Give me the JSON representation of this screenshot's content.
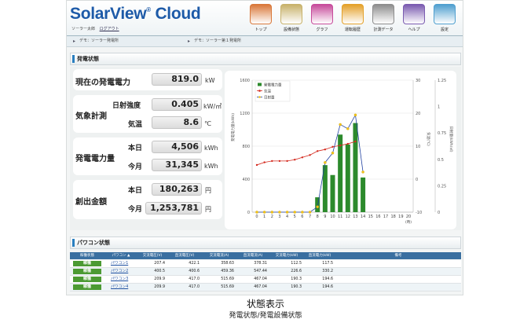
{
  "app": {
    "logo": "SolarView",
    "logo_reg": "®",
    "logo_suffix": " Cloud",
    "login": {
      "user": "ソーラー太郎",
      "logout": "ログアウト"
    }
  },
  "nav": [
    {
      "label": "トップ",
      "icon": "house-icon",
      "color": "#d9783a"
    },
    {
      "label": "設備状態",
      "icon": "panel-icon",
      "color": "#c8b26b"
    },
    {
      "label": "グラフ",
      "icon": "bar-graph-icon",
      "color": "#c74b9b"
    },
    {
      "label": "運転履歴",
      "icon": "log-icon",
      "color": "#e4a12a"
    },
    {
      "label": "計測データ",
      "icon": "data-icon",
      "color": "#8d8d8d"
    },
    {
      "label": "ヘルプ",
      "icon": "help-icon",
      "color": "#7a5bb0"
    },
    {
      "label": "設定",
      "icon": "settings-icon",
      "color": "#4f9fcf"
    }
  ],
  "breadcrumbs": [
    "デモ：ソーラー発電所",
    "デモ：ソーラー第１発電所"
  ],
  "status": {
    "title": "発電状態",
    "current_power": {
      "label": "現在の発電電力",
      "value": "819.0",
      "unit": "kW"
    },
    "weather": {
      "label": "気象計測",
      "irradiance": {
        "label": "日射強度",
        "value": "0.405",
        "unit": "kW/㎡"
      },
      "temperature": {
        "label": "気温",
        "value": "8.6",
        "unit": "℃"
      }
    },
    "energy": {
      "label": "発電電力量",
      "today": {
        "label": "本日",
        "value": "4,506",
        "unit": "kWh"
      },
      "month": {
        "label": "今月",
        "value": "31,345",
        "unit": "kWh"
      }
    },
    "money": {
      "label": "創出金額",
      "today": {
        "label": "本日",
        "value": "180,263",
        "unit": "円"
      },
      "month": {
        "label": "今月",
        "value": "1,253,781",
        "unit": "円"
      }
    }
  },
  "chart_data": {
    "type": "bar",
    "x": [
      0,
      1,
      2,
      3,
      4,
      5,
      6,
      7,
      8,
      9,
      10,
      11,
      12,
      13,
      14,
      15,
      16,
      17,
      18,
      19,
      20
    ],
    "xlabel": "(時)",
    "series": [
      {
        "name": "発電電力量",
        "type": "bar",
        "axis": "left",
        "color": "#2c8a2c",
        "values": [
          0,
          0,
          0,
          0,
          0,
          0,
          0,
          0,
          180,
          570,
          450,
          940,
          820,
          1080,
          420,
          null,
          null,
          null,
          null,
          null,
          null
        ]
      },
      {
        "name": "気温",
        "type": "line",
        "axis": "right1",
        "color": "#d42a1f",
        "values": [
          null,
          null,
          null,
          null,
          null,
          null,
          null,
          null,
          null,
          null,
          null,
          null,
          null,
          null,
          null,
          null,
          null,
          null,
          null,
          null,
          null
        ]
      },
      {
        "name": "日射量",
        "type": "line",
        "axis": "right2",
        "color": "#2040a0",
        "marker_color": "#f3c41a",
        "values": [
          0,
          0,
          0,
          0,
          0,
          0,
          0,
          0,
          0.05,
          0.47,
          0.56,
          0.83,
          0.79,
          0.92,
          0.38,
          null,
          null,
          null,
          null,
          null,
          null
        ]
      }
    ],
    "temperature": {
      "hours": [
        0,
        1,
        2,
        3,
        4,
        5,
        6,
        7,
        8,
        9,
        10,
        11,
        12,
        13
      ],
      "values": [
        4.3,
        5.1,
        5.5,
        5.5,
        5.5,
        5.9,
        6.6,
        7.3,
        8.5,
        9.0,
        9.8,
        10.2,
        10.7,
        11.4
      ]
    },
    "left_axis": {
      "label": "発電電力量(kWh)",
      "ticks": [
        "0",
        "400",
        "800",
        "1200",
        "1600"
      ],
      "ylim": [
        0,
        1600
      ]
    },
    "right_axis1": {
      "label": "気温(℃)",
      "ticks": [
        "-10",
        "0",
        "10",
        "20",
        "30"
      ],
      "ylim": [
        -10,
        30
      ]
    },
    "right_axis2": {
      "label": "日射量(kWh/㎡)",
      "ticks": [
        "0",
        "0.25",
        "0.5",
        "0.75",
        "1",
        "1.25"
      ],
      "ylim": [
        0,
        1.25
      ]
    },
    "xticks": [
      "0",
      "1",
      "2",
      "3",
      "4",
      "5",
      "6",
      "7",
      "8",
      "9",
      "10",
      "11",
      "12",
      "13",
      "14",
      "15",
      "16",
      "17",
      "18",
      "19",
      "20"
    ],
    "legend": [
      "発電電力量",
      "気温",
      "日射量"
    ],
    "legend_position": "top-left"
  },
  "pcs": {
    "title": "パワコン状態",
    "headers": [
      "稼働状態",
      "パワコン ▲",
      "交流電圧(V)",
      "直流電圧(V)",
      "交流電流(A)",
      "直流電流(A)",
      "交流電力(kW)",
      "直流電力(kW)",
      "備考"
    ],
    "rows": [
      {
        "status": "稼働",
        "name": "パワコン1",
        "cells": [
          "207.4",
          "422.1",
          "358.63",
          "378.31",
          "112.5",
          "117.5",
          ""
        ]
      },
      {
        "status": "稼働",
        "name": "パワコン2",
        "cells": [
          "400.5",
          "400.6",
          "459.36",
          "547.44",
          "226.6",
          "330.2",
          ""
        ]
      },
      {
        "status": "稼働",
        "name": "パワコン3",
        "cells": [
          "209.9",
          "417.0",
          "515.69",
          "467.04",
          "190.3",
          "194.6",
          ""
        ]
      },
      {
        "status": "稼働",
        "name": "パワコン4",
        "cells": [
          "209.9",
          "417.0",
          "515.69",
          "467.04",
          "190.3",
          "194.6",
          ""
        ]
      }
    ]
  },
  "caption": {
    "title": "状態表示",
    "subtitle": "発電状態/発電設備状態"
  }
}
